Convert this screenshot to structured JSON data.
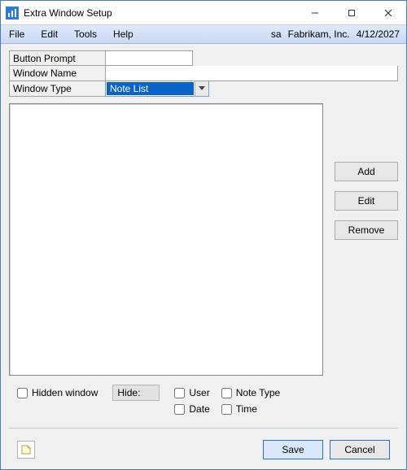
{
  "window": {
    "title": "Extra Window Setup"
  },
  "menu": {
    "file": "File",
    "edit": "Edit",
    "tools": "Tools",
    "help": "Help",
    "user": "sa",
    "company": "Fabrikam, Inc.",
    "date": "4/12/2027"
  },
  "fields": {
    "button_prompt_label": "Button Prompt",
    "button_prompt_value": "",
    "window_name_label": "Window Name",
    "window_name_value": "",
    "window_type_label": "Window Type",
    "window_type_value": "Note List"
  },
  "buttons": {
    "add": "Add",
    "edit": "Edit",
    "remove": "Remove",
    "save": "Save",
    "cancel": "Cancel"
  },
  "options": {
    "hidden_window": "Hidden window",
    "hide_label": "Hide:",
    "user": "User",
    "note_type": "Note Type",
    "date": "Date",
    "time": "Time"
  }
}
